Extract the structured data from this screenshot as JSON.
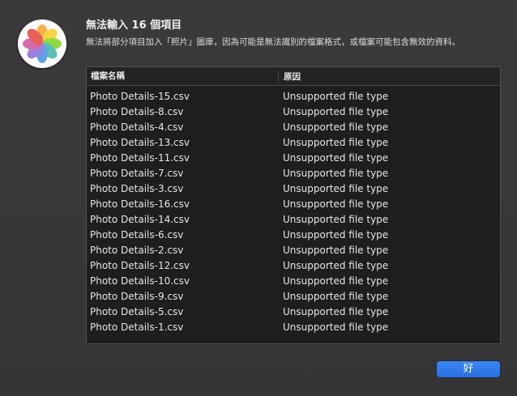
{
  "dialog": {
    "title": "無法輸入 16 個項目",
    "message": "無法將部分項目加入「照片」圖庫，因為可能是無法識別的檔案格式，或檔案可能包含無效的資料。",
    "app_icon": "photos-icon",
    "ok_label": "好",
    "accent_color": "#2f7cf6"
  },
  "table": {
    "columns": [
      "檔案名稱",
      "原因"
    ],
    "rows": [
      {
        "name": "Photo Details-15.csv",
        "reason": "Unsupported file type"
      },
      {
        "name": "Photo Details-8.csv",
        "reason": "Unsupported file type"
      },
      {
        "name": "Photo Details-4.csv",
        "reason": "Unsupported file type"
      },
      {
        "name": "Photo Details-13.csv",
        "reason": "Unsupported file type"
      },
      {
        "name": "Photo Details-11.csv",
        "reason": "Unsupported file type"
      },
      {
        "name": "Photo Details-7.csv",
        "reason": "Unsupported file type"
      },
      {
        "name": "Photo Details-3.csv",
        "reason": "Unsupported file type"
      },
      {
        "name": "Photo Details-16.csv",
        "reason": "Unsupported file type"
      },
      {
        "name": "Photo Details-14.csv",
        "reason": "Unsupported file type"
      },
      {
        "name": "Photo Details-6.csv",
        "reason": "Unsupported file type"
      },
      {
        "name": "Photo Details-2.csv",
        "reason": "Unsupported file type"
      },
      {
        "name": "Photo Details-12.csv",
        "reason": "Unsupported file type"
      },
      {
        "name": "Photo Details-10.csv",
        "reason": "Unsupported file type"
      },
      {
        "name": "Photo Details-9.csv",
        "reason": "Unsupported file type"
      },
      {
        "name": "Photo Details-5.csv",
        "reason": "Unsupported file type"
      },
      {
        "name": "Photo Details-1.csv",
        "reason": "Unsupported file type"
      }
    ]
  }
}
